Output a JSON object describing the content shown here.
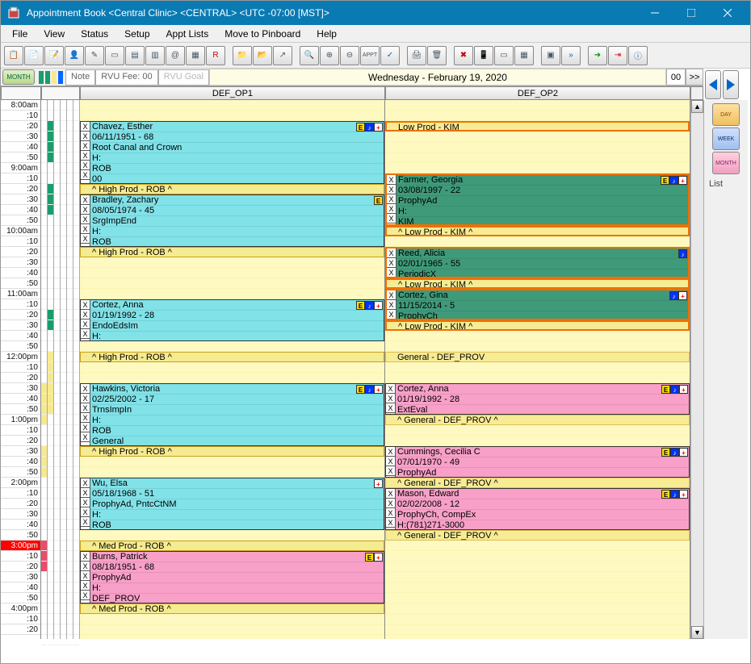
{
  "title": "Appointment Book <Central Clinic> <CENTRAL> <UTC -07:00 [MST]>",
  "menu": [
    "File",
    "View",
    "Status",
    "Setup",
    "Appt Lists",
    "Move to Pinboard",
    "Help"
  ],
  "subbar": {
    "month_label": "MONTH",
    "note": "Note",
    "rvu_fee": "RVU Fee: 00",
    "rvu_goal": "RVU Goal",
    "date": "Wednesday - February 19, 2020",
    "num": "00",
    "arrow": ">>"
  },
  "columns": [
    "DEF_OP1",
    "DEF_OP2"
  ],
  "time_start_h": 8,
  "rpanel_list": "List",
  "labels": {
    "low": "Low Prod - KIM",
    "low_c": "^ Low Prod - KIM ^",
    "high": "High Prod - ROB",
    "high_c": "^ High Prod - ROB ^",
    "med_c": "^ Med Prod - ROB ^",
    "gen": "General - DEF_PROV",
    "gen_c": "^ General - DEF_PROV ^"
  },
  "ap": {
    "chavez": {
      "l1": "Chavez, Esther",
      "l2": "06/11/1951 - 68",
      "l3": "Root Canal and Crown",
      "l4": "H:",
      "l5": "ROB",
      "l6": "00"
    },
    "bradley": {
      "l1": "Bradley, Zachary",
      "l2": "08/05/1974 - 45",
      "l3": "SrgImpEnd",
      "l4": "H:",
      "l5": "ROB"
    },
    "cortezA": {
      "l1": "Cortez, Anna",
      "l2": "01/19/1992 - 28",
      "l3": "EndoEdsIm",
      "l4": "H:"
    },
    "hawkins": {
      "l1": "Hawkins, Victoria",
      "l2": "02/25/2002 - 17",
      "l3": "TrnsImpIn",
      "l4": "H:",
      "l5": "ROB",
      "l6": "General"
    },
    "wu": {
      "l1": "Wu, Elsa",
      "l2": "05/18/1968 - 51",
      "l3": "ProphyAd, PntcCtNM",
      "l4": "H:",
      "l5": "ROB"
    },
    "burns": {
      "l1": "Burns, Patrick",
      "l2": "08/18/1951 - 68",
      "l3": "ProphyAd",
      "l4": "H:",
      "l5": "DEF_PROV"
    },
    "farmer": {
      "l1": "Farmer, Georgia",
      "l2": "03/08/1997 - 22",
      "l3": "ProphyAd",
      "l4": "H:",
      "l5": "KIM"
    },
    "reed": {
      "l1": "Reed, Alicia",
      "l2": "02/01/1965 - 55",
      "l3": "PeriodicX"
    },
    "cortezG": {
      "l1": "Cortez, Gina",
      "l2": "11/15/2014 - 5",
      "l3": "ProphyCh"
    },
    "cortezA2": {
      "l1": "Cortez, Anna",
      "l2": "01/19/1992 - 28",
      "l3": "ExtEval"
    },
    "cummings": {
      "l1": "Cummings, Cecilia C",
      "l2": "07/01/1970 - 49",
      "l3": "ProphyAd"
    },
    "mason": {
      "l1": "Mason, Edward",
      "l2": "02/02/2008 - 12",
      "l3": "ProphyCh, CompEx",
      "l4": "H:(781)271-3000"
    }
  }
}
